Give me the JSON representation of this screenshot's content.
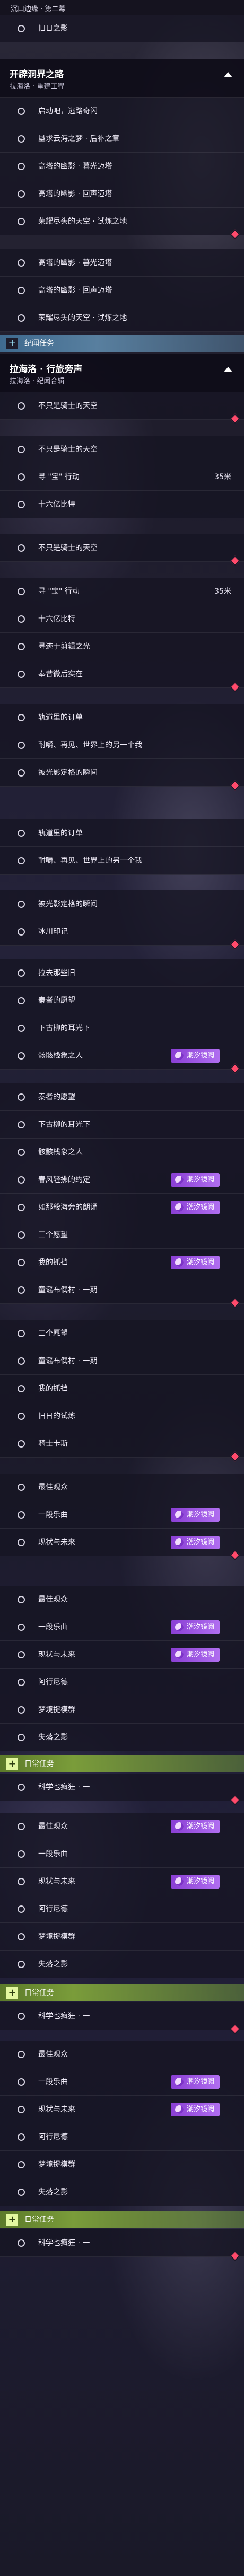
{
  "top_strip_text": "沉口边缘 · 第二幕",
  "mark_color": "#ff4a6b",
  "badge_color": "#8a3fd4",
  "sections": [
    {
      "title": "开辟洞界之路",
      "subtitle": "拉海洛 · 重建工程"
    },
    {
      "title": "拉海洛 · 行旅旁声",
      "subtitle": "拉海洛 · 纪闻合辑"
    }
  ],
  "tags": {
    "legend": "纪闻任务",
    "daily": "日常任务"
  },
  "badge_text": "潮汐镜阙",
  "items": {
    "i0": "旧日之影",
    "i1": "启动吧，逃路奇闪",
    "i2": "垦求云海之梦 · 后补之章",
    "i3": "高塔的幽影 · 暮光迈塔",
    "i4": "高塔的幽影 · 回声迈塔",
    "i5": "荣耀尽头的天空 · 试炼之地",
    "i6": "高塔的幽影 · 暮光迈塔",
    "i7": "高塔的幽影 · 回声迈塔",
    "i8": "荣耀尽头的天空 · 试炼之地",
    "i9": "不只是骑士的天空",
    "i10": "不只是骑士的天空",
    "i11": "寻 \"宝\" 行动",
    "i12": "十六亿比特",
    "i13": "不只是骑士的天空",
    "i14": "寻 \"宝\" 行动",
    "i15": "十六亿比特",
    "i16": "寻迹于剪辑之光",
    "i17": "奉昔微后实在",
    "i18": "轨道里的订单",
    "i19": "耐嚼、再见、世界上的另一个我",
    "i20": "被光影定格的瞬间",
    "i21": "轨道里的订单",
    "i22": "耐嚼、再见、世界上的另一个我",
    "i23": "被光影定格的瞬间",
    "i24": "冰川印记",
    "i25": "拉去那些旧",
    "i26": "秦者的愿望",
    "i27": "下古柳的耳光下",
    "i28": "骸骸栈象之人",
    "i29": "秦者的愿望",
    "i30": "下古柳的耳光下",
    "i31": "骸骸栈象之人",
    "i32": "春风轻拂的约定",
    "i33": "如那般海旁的朗诵",
    "i34": "三个愿望",
    "i35": "我的抓挡",
    "i36": "童谣布偶村 · 一期",
    "i37": "三个愿望",
    "i38": "童谣布偶村 · 一期",
    "i39": "我的抓挡",
    "i40": "旧日的试炼",
    "i41": "骑士卡斯",
    "i42": "最佳观众",
    "i43": "一段乐曲",
    "i44": "现状与未来",
    "i45": "最佳观众",
    "i46": "一段乐曲",
    "i47": "现状与未来",
    "i48": "阿行尼德",
    "i49": "梦境捉模群",
    "i50": "失落之影",
    "i51": "科学也疯狂 · 一",
    "i52": "最佳观众",
    "i53": "一段乐曲",
    "i54": "现状与未来",
    "i55": "阿行尼德",
    "i56": "梦境捉模群",
    "i57": "失落之影",
    "i58": "科学也疯狂 · 一",
    "i59": "最佳观众",
    "i60": "一段乐曲",
    "i61": "现状与未来",
    "i62": "阿行尼德",
    "i63": "梦境捉模群",
    "i64": "失落之影",
    "i65": "科学也疯狂 · 一"
  },
  "distance": "35米"
}
